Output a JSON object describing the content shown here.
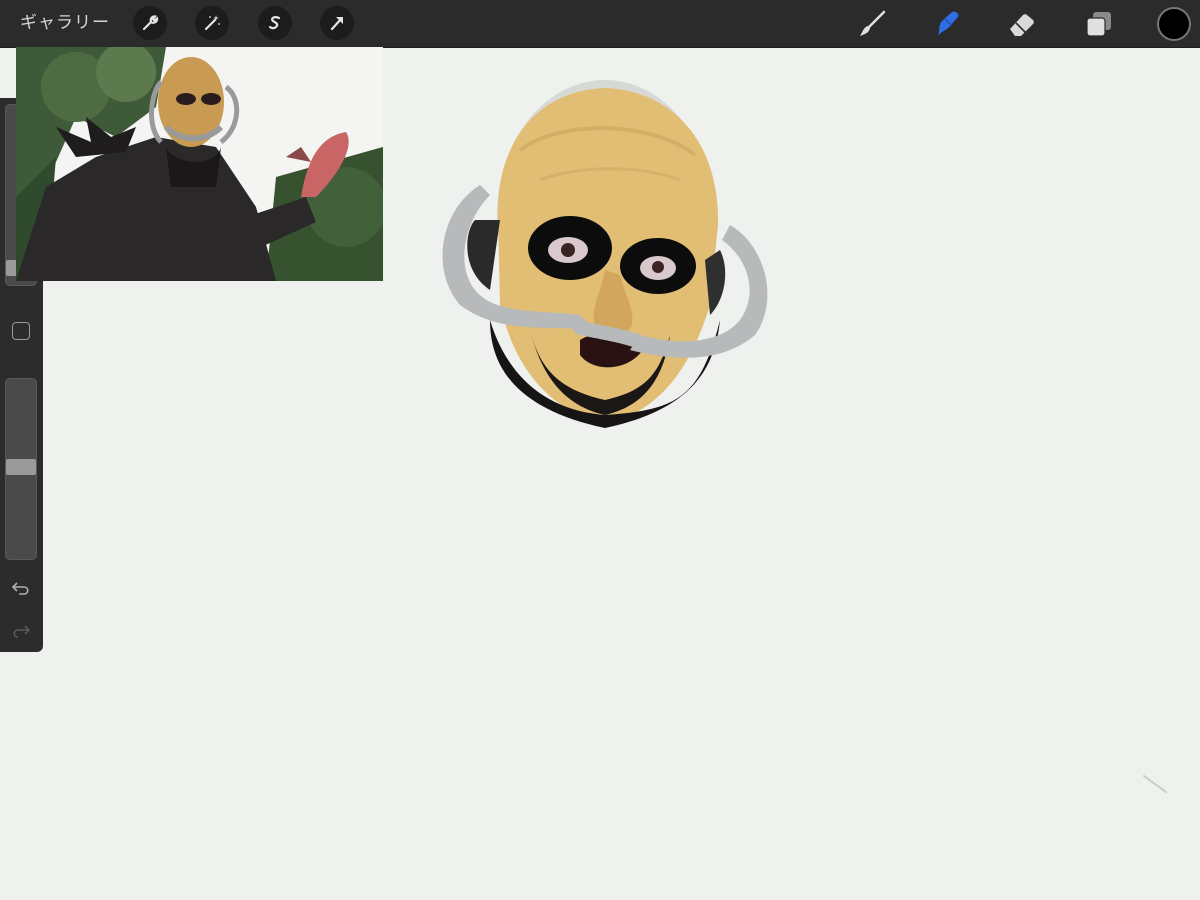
{
  "topbar": {
    "gallery_label": "ギャラリー",
    "left_tools": [
      "wrench-icon",
      "magic-wand-icon",
      "selection-s-icon",
      "transform-arrow-icon"
    ],
    "right_tools": [
      "brush-icon",
      "smudge-icon",
      "eraser-icon",
      "layers-icon"
    ],
    "active_tool": "smudge-icon",
    "active_color": "#000000",
    "accent_color": "#2f6fe6"
  },
  "sidebar": {
    "size_slider_value": 0.1,
    "opacity_slider_value": 0.52,
    "icons": [
      "modify-square-icon",
      "undo-icon",
      "redo-icon"
    ]
  }
}
